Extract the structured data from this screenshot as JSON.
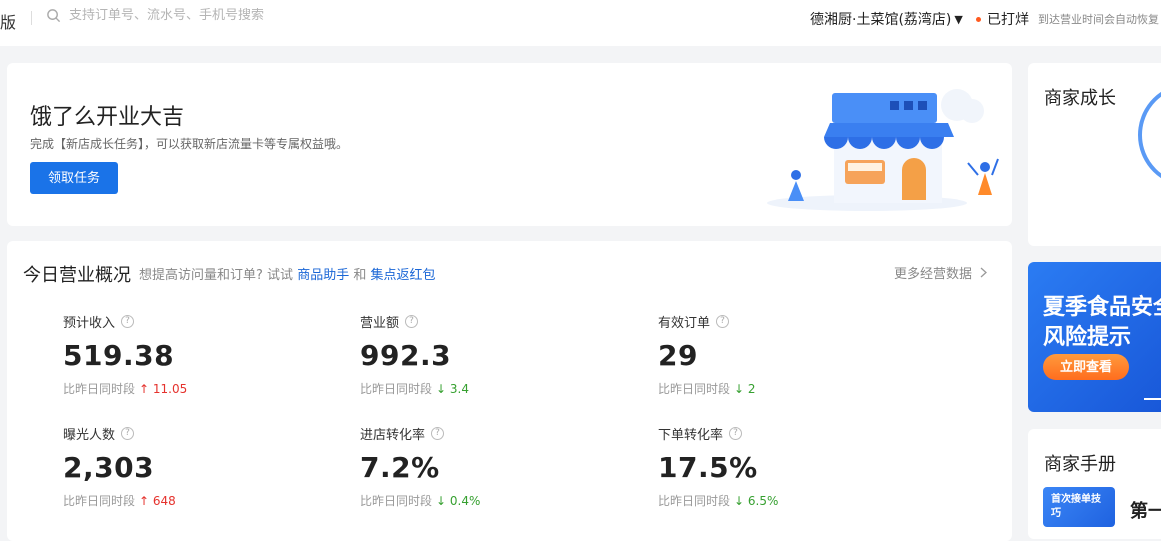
{
  "topbar": {
    "brand_tail": "版",
    "search_placeholder": "支持订单号、流水号、手机号搜索",
    "store_name": "德湘厨·土菜馆(荔湾店)",
    "status": "已打烊",
    "status_hint": "到达营业时间会自动恢复"
  },
  "banner": {
    "title": "饿了么开业大吉",
    "desc": "完成【新店成长任务】，可以获取新店流量卡等专属权益哦。",
    "button": "领取任务"
  },
  "overview": {
    "title": "今日营业概况",
    "tip_prefix": "想提高访问量和订单? 试试",
    "tip_link1": "商品助手",
    "tip_and": "和",
    "tip_link2": "集点返红包",
    "more": "更多经营数据",
    "compare_label": "比昨日同时段",
    "metrics": [
      {
        "label": "预计收入",
        "value": "519.38",
        "dir": "↑",
        "delta": "11.05"
      },
      {
        "label": "营业额",
        "value": "992.3",
        "dir": "↓",
        "delta": "3.4"
      },
      {
        "label": "有效订单",
        "value": "29",
        "dir": "↓",
        "delta": "2"
      },
      {
        "label": "曝光人数",
        "value": "2,303",
        "dir": "↑",
        "delta": "648"
      },
      {
        "label": "进店转化率",
        "value": "7.2%",
        "dir": "↓",
        "delta": "0.4%"
      },
      {
        "label": "下单转化率",
        "value": "17.5%",
        "dir": "↓",
        "delta": "6.5%"
      }
    ]
  },
  "growth": {
    "title": "商家成长"
  },
  "promo": {
    "line1": "夏季食品安全",
    "line2": "风险提示",
    "button": "立即查看"
  },
  "manual": {
    "title": "商家手册",
    "thumb_text": "首次接单技巧",
    "item": "第一"
  },
  "colors": {
    "primary": "#1a73e8",
    "up": "#e5322d",
    "down": "#36a030",
    "accent_orange": "#ff6d1e"
  }
}
